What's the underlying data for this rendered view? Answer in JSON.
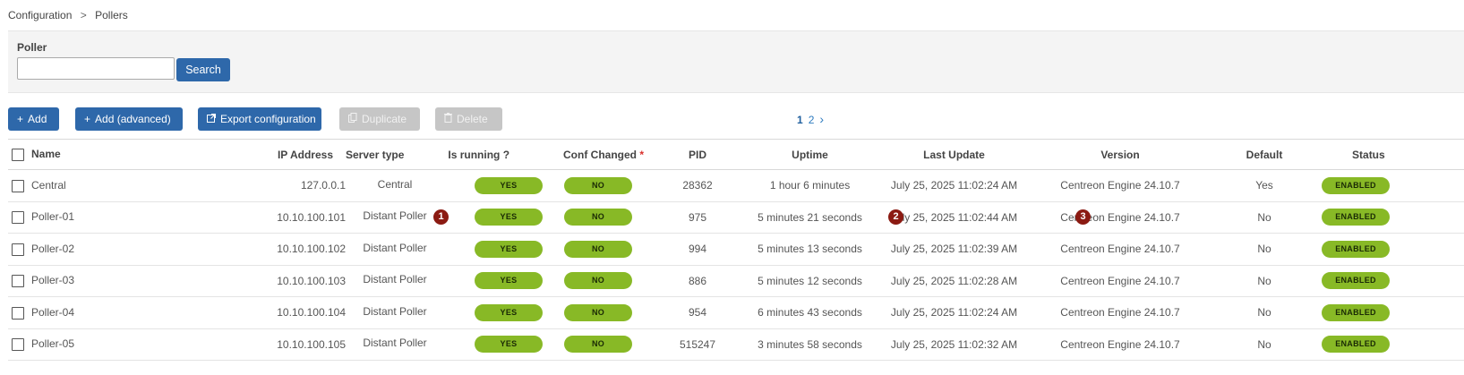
{
  "breadcrumb": {
    "parent": "Configuration",
    "separator": ">",
    "current": "Pollers"
  },
  "filter": {
    "label": "Poller",
    "value": "",
    "search_label": "Search"
  },
  "toolbar": {
    "add": "Add",
    "add_advanced": "Add (advanced)",
    "export": "Export configuration",
    "duplicate": "Duplicate",
    "delete": "Delete"
  },
  "pagination": {
    "pages": [
      "1",
      "2"
    ],
    "current": "1",
    "next": "›"
  },
  "table": {
    "headers": {
      "name": "Name",
      "ip": "IP Address",
      "server_type": "Server type",
      "running": "Is running ?",
      "conf_changed": "Conf Changed",
      "required_mark": "*",
      "pid": "PID",
      "uptime": "Uptime",
      "last_update": "Last Update",
      "version": "Version",
      "default": "Default",
      "status": "Status"
    },
    "rows": [
      {
        "name": "Central",
        "ip": "127.0.0.1",
        "server_type": "Central",
        "running": "YES",
        "conf_changed": "NO",
        "pid": "28362",
        "uptime": "1 hour 6 minutes",
        "last_update": "July 25, 2025 11:02:24 AM",
        "version": "Centreon Engine 24.10.7",
        "default": "Yes",
        "status": "ENABLED"
      },
      {
        "name": "Poller-01",
        "ip": "10.10.100.101",
        "server_type": "Distant Poller",
        "running": "YES",
        "conf_changed": "NO",
        "pid": "975",
        "uptime": "5 minutes 21 seconds",
        "last_update": "July 25, 2025 11:02:44 AM",
        "version": "Centreon Engine 24.10.7",
        "default": "No",
        "status": "ENABLED"
      },
      {
        "name": "Poller-02",
        "ip": "10.10.100.102",
        "server_type": "Distant Poller",
        "running": "YES",
        "conf_changed": "NO",
        "pid": "994",
        "uptime": "5 minutes 13 seconds",
        "last_update": "July 25, 2025 11:02:39 AM",
        "version": "Centreon Engine 24.10.7",
        "default": "No",
        "status": "ENABLED"
      },
      {
        "name": "Poller-03",
        "ip": "10.10.100.103",
        "server_type": "Distant Poller",
        "running": "YES",
        "conf_changed": "NO",
        "pid": "886",
        "uptime": "5 minutes 12 seconds",
        "last_update": "July 25, 2025 11:02:28 AM",
        "version": "Centreon Engine 24.10.7",
        "default": "No",
        "status": "ENABLED"
      },
      {
        "name": "Poller-04",
        "ip": "10.10.100.104",
        "server_type": "Distant Poller",
        "running": "YES",
        "conf_changed": "NO",
        "pid": "954",
        "uptime": "6 minutes 43 seconds",
        "last_update": "July 25, 2025 11:02:24 AM",
        "version": "Centreon Engine 24.10.7",
        "default": "No",
        "status": "ENABLED"
      },
      {
        "name": "Poller-05",
        "ip": "10.10.100.105",
        "server_type": "Distant Poller",
        "running": "YES",
        "conf_changed": "NO",
        "pid": "515247",
        "uptime": "3 minutes 58 seconds",
        "last_update": "July 25, 2025 11:02:32 AM",
        "version": "Centreon Engine 24.10.7",
        "default": "No",
        "status": "ENABLED"
      }
    ]
  },
  "annotations": [
    "1",
    "2",
    "3"
  ],
  "colors": {
    "primary": "#2e68aa",
    "pill_green": "#88b926",
    "marker_red": "#8b1a12",
    "disabled": "#c6c6c6"
  }
}
